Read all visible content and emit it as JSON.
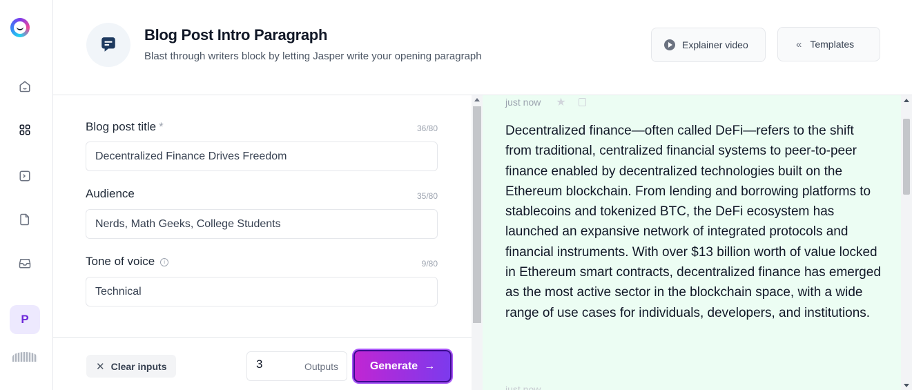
{
  "sidebar": {
    "logo_icon": "jasper-logo-icon",
    "items": [
      {
        "icon": "home-icon"
      },
      {
        "icon": "grid-icon"
      },
      {
        "icon": "terminal-icon"
      },
      {
        "icon": "document-icon"
      },
      {
        "icon": "inbox-icon"
      }
    ],
    "avatar_letter": "P"
  },
  "header": {
    "template_icon": "chat-bubble-icon",
    "title": "Blog Post Intro Paragraph",
    "subtitle": "Blast through writers block by letting Jasper write your opening paragraph",
    "explainer_label": "Explainer video",
    "templates_label": "Templates"
  },
  "form": {
    "fields": [
      {
        "label": "Blog post title",
        "required_mark": "*",
        "counter": "36/80",
        "value": "Decentralized Finance Drives Freedom"
      },
      {
        "label": "Audience",
        "counter": "35/80",
        "value": "Nerds, Math Geeks, College Students"
      },
      {
        "label": "Tone of voice",
        "info_icon": "info-icon",
        "info_glyph": "i",
        "counter": "9/80",
        "value": "Technical"
      }
    ]
  },
  "footer": {
    "clear_label": "Clear inputs",
    "clear_glyph": "✕",
    "outputs_value": "3",
    "outputs_label": "Outputs",
    "generate_label": "Generate",
    "generate_arrow": "→"
  },
  "output": {
    "timestamp": "just now",
    "text": "Decentralized finance—often called DeFi—refers to the shift from traditional, centralized financial systems to peer-to-peer finance enabled by decentralized technologies built on the Ethereum blockchain. From lending and borrowing platforms to stablecoins and tokenized BTC, the DeFi ecosystem has launched an expansive network of integrated protocols and financial instruments. With over $13 billion worth of value locked in Ethereum smart contracts, decentralized finance has emerged as the most active sector in the blockchain space, with a wide range of use cases for individuals, developers, and institutions.",
    "next_timestamp": "just now"
  },
  "colors": {
    "accent": "#7c3aed",
    "generate_start": "#c026d3",
    "output_bg": "#ecfdf3"
  }
}
